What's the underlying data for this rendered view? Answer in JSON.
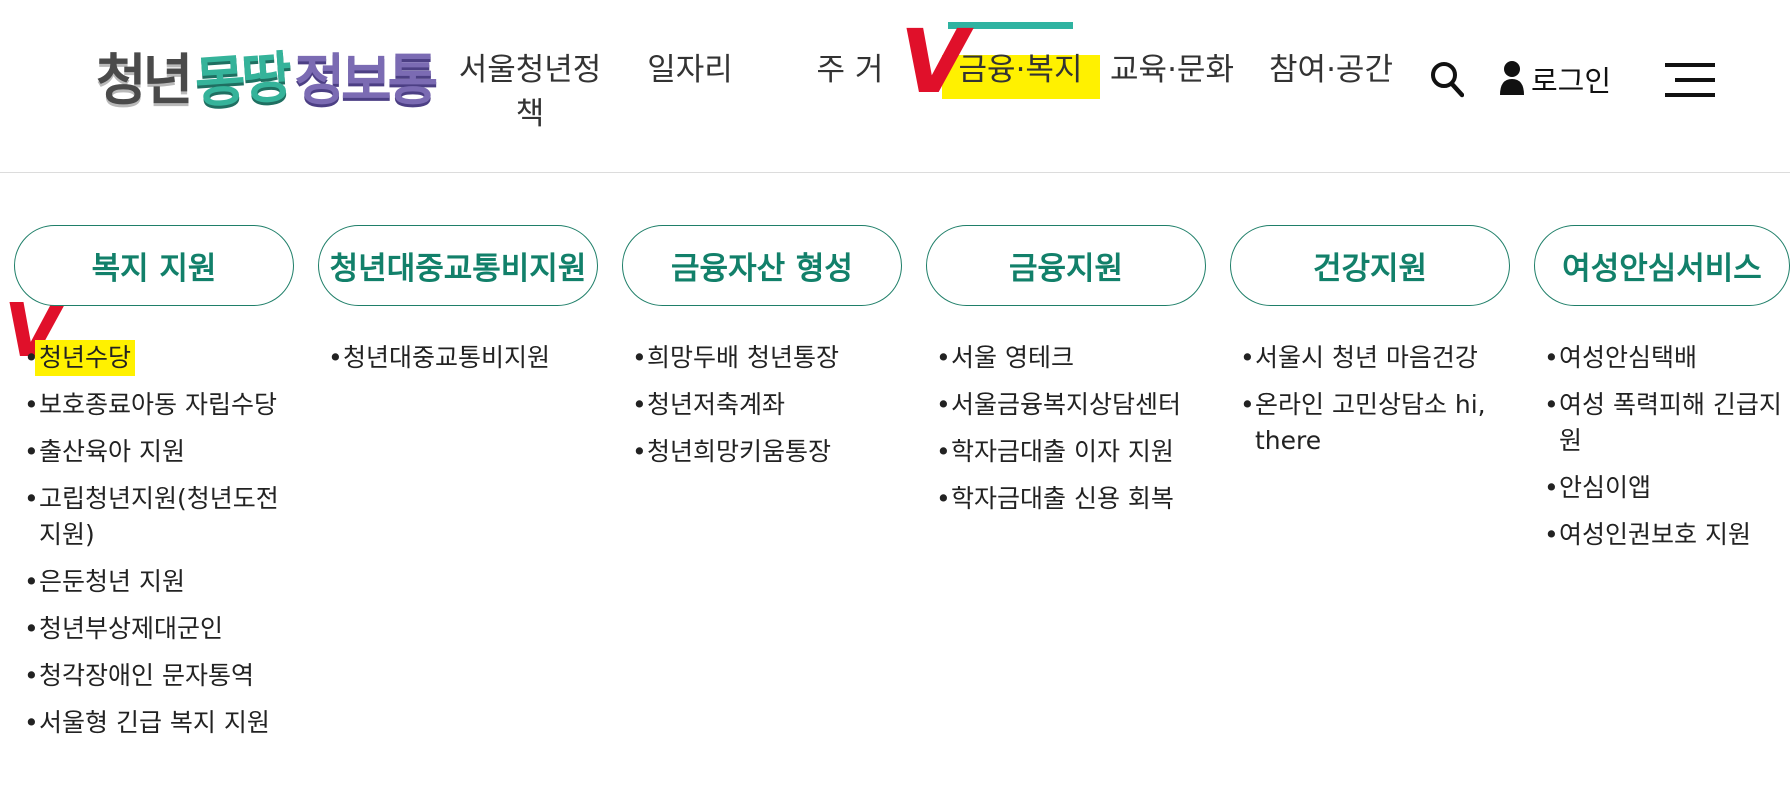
{
  "logo": {
    "part1": "청년",
    "part2": "몽땅",
    "part3": "정보통"
  },
  "nav": {
    "items": [
      {
        "label": "서울청년정책"
      },
      {
        "label": "일자리"
      },
      {
        "label": "주 거"
      },
      {
        "label": "금융·복지"
      },
      {
        "label": "교육·문화"
      },
      {
        "label": "참여·공간"
      }
    ],
    "active_index": 3,
    "login_label": "로그인"
  },
  "colors": {
    "accent": "#2fb3a1",
    "pill_border": "#1f7f69",
    "pill_text": "#12806a",
    "highlight": "#fff100",
    "check_mark": "#e0102a"
  },
  "icons": {
    "search": "search-icon",
    "user": "user-icon",
    "menu": "menu-icon",
    "check": "check-mark-icon"
  },
  "annotations": {
    "check_mark": "V"
  },
  "columns": [
    {
      "title": "복지 지원",
      "items": [
        "청년수당",
        "보호종료아동 자립수당",
        "출산육아 지원",
        "고립청년지원(청년도전지원)",
        "은둔청년 지원",
        "청년부상제대군인",
        "청각장애인 문자통역",
        "서울형 긴급 복지 지원"
      ]
    },
    {
      "title": "청년대중교통비지원",
      "items": [
        "청년대중교통비지원"
      ]
    },
    {
      "title": "금융자산 형성",
      "items": [
        "희망두배 청년통장",
        "청년저축계좌",
        "청년희망키움통장"
      ]
    },
    {
      "title": "금융지원",
      "items": [
        "서울 영테크",
        "서울금융복지상담센터",
        "학자금대출 이자 지원",
        "학자금대출 신용 회복"
      ]
    },
    {
      "title": "건강지원",
      "items": [
        "서울시 청년 마음건강",
        "온라인 고민상담소 hi, there"
      ]
    },
    {
      "title": "여성안심서비스",
      "items": [
        "여성안심택배",
        "여성 폭력피해 긴급지원",
        "안심이앱",
        "여성인권보호 지원"
      ]
    }
  ]
}
